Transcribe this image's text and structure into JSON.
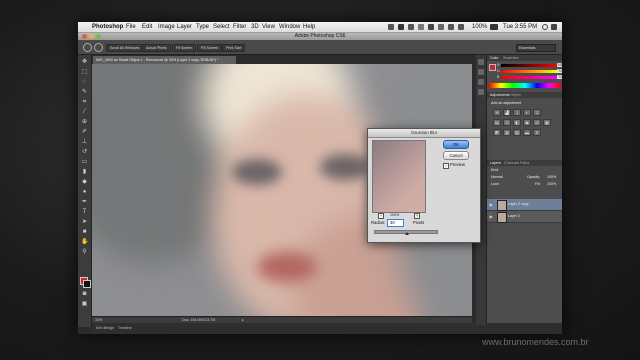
{
  "menubar": {
    "app": "Photoshop",
    "items": [
      "File",
      "Edit",
      "Image",
      "Layer",
      "Type",
      "Select",
      "Filter",
      "3D",
      "View",
      "Window",
      "Help"
    ],
    "battery": "100%",
    "clock": "Tue 3:55 PM"
  },
  "window": {
    "title": "Adobe Photoshop CS6"
  },
  "options_bar": {
    "buttons": [
      "Scroll All Windows",
      "Actual Pixels",
      "Fit Screen",
      "Fill Screen",
      "Print Size"
    ],
    "workspace": "Essentials"
  },
  "document": {
    "tab_title": "IMG_2694 as Smart Object-1 - Recovered @ 33% (Layer 2 copy, RGB/16*) *",
    "zoom": "33%",
    "doc_size": "Doc: 145.0M/215.7M"
  },
  "bottom_bar": {
    "items": [
      "Mini Bridge",
      "Timeline"
    ]
  },
  "panels": {
    "color_tabs": [
      "Color",
      "Swatches"
    ],
    "color_rows": [
      {
        "label": "R",
        "value": "245"
      },
      {
        "label": "G",
        "value": "72"
      },
      {
        "label": "B",
        "value": "72"
      }
    ],
    "adjust_tabs": [
      "Adjustments",
      "Styles"
    ],
    "adjust_title": "Add an adjustment",
    "layers_tabs": [
      "Layers",
      "Channels",
      "Paths"
    ],
    "blend_mode": "Normal",
    "opacity_label": "Opacity:",
    "opacity_value": "100%",
    "lock_label": "Lock:",
    "fill_label": "Fill:",
    "fill_value": "100%",
    "kind_label": "Kind",
    "layers": [
      {
        "name": "Layer 2 copy",
        "selected": true
      },
      {
        "name": "Layer 2",
        "selected": false
      }
    ]
  },
  "dialog": {
    "title": "Gaussian Blur",
    "ok": "OK",
    "cancel": "Cancel",
    "preview_label": "Preview",
    "preview_checked": true,
    "zoom": "100%",
    "zoom_minus": "−",
    "zoom_plus": "+",
    "radius_label": "Radius:",
    "radius_value": "30",
    "radius_unit": "Pixels",
    "slider_level": 0.52
  },
  "watermark": "www.brunomendes.com.br",
  "colors": {
    "foreground": "#d0232a",
    "background": "#111111",
    "ok_button": "#3f7fd8",
    "selected_layer": "#6d7f99"
  }
}
